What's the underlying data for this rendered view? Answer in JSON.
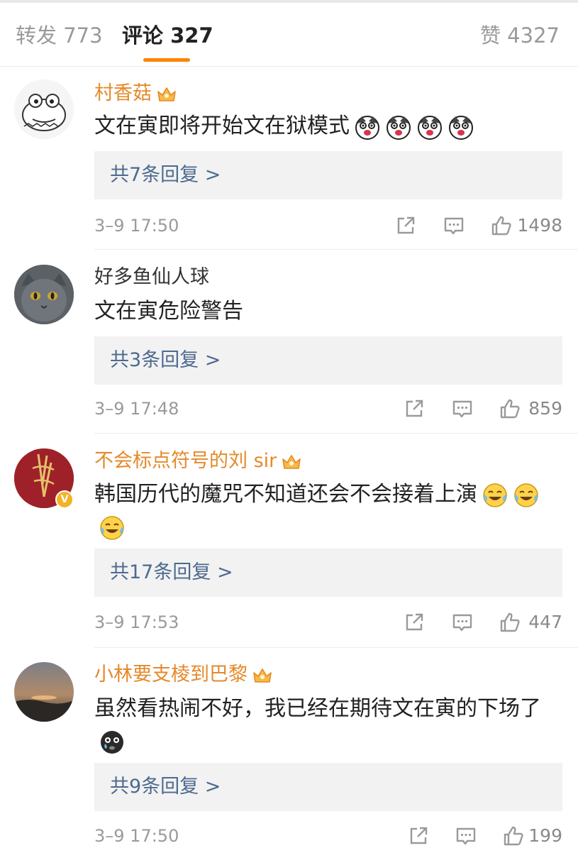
{
  "tabs": {
    "repost": "转发 773",
    "comment": "评论 327",
    "like": "赞 4327"
  },
  "colors": {
    "accent": "#ff8200",
    "vip_name": "#e5892a",
    "reply_link": "#4d6a8f",
    "muted": "#9a9a9a"
  },
  "comments": [
    {
      "username": "村香菇",
      "vip": true,
      "text": "文在寅即将开始文在狱模式",
      "emoji": [
        "husky-emoji",
        "husky-emoji",
        "husky-emoji",
        "husky-emoji"
      ],
      "replies": "共7条回复 >",
      "time": "3–9 17:50",
      "likes": "1498"
    },
    {
      "username": "好多鱼仙人球",
      "vip": false,
      "text": "文在寅危险警告",
      "emoji": [],
      "replies": "共3条回复 >",
      "time": "3–9 17:48",
      "likes": "859"
    },
    {
      "username": "不会标点符号的刘 sir",
      "vip": true,
      "verified": true,
      "text": "韩国历代的魔咒不知道还会不会接着上演",
      "emoji": [
        "laugh-cry-emoji",
        "laugh-cry-emoji",
        "laugh-cry-emoji"
      ],
      "replies": "共17条回复 >",
      "time": "3–9 17:53",
      "likes": "447"
    },
    {
      "username": "小林要支棱到巴黎",
      "vip": true,
      "text": "虽然看热闹不好，我已经在期待文在寅的下场了",
      "emoji": [
        "crying-black-emoji"
      ],
      "replies": "共9条回复 >",
      "time": "3–9 17:50",
      "likes": "199"
    }
  ]
}
